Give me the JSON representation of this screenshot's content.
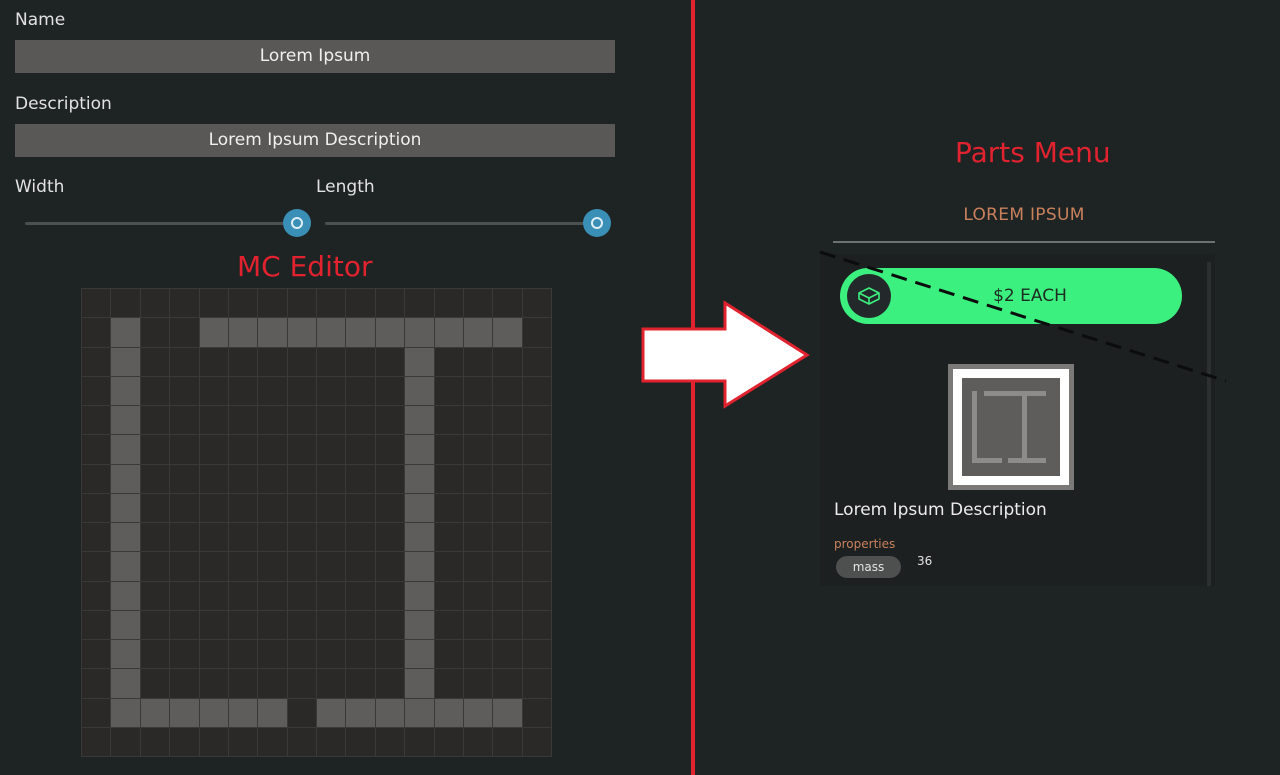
{
  "editor": {
    "name_label": "Name",
    "name_value": "Lorem Ipsum",
    "description_label": "Description",
    "description_value": "Lorem Ipsum Description",
    "width_label": "Width",
    "length_label": "Length",
    "width_slider_value": 1.0,
    "length_slider_value": 1.0,
    "annotation": "MC Editor",
    "grid": {
      "cols": 16,
      "rows": 16,
      "cells": [
        "0000000000000000",
        "0100111111111110",
        "0100000000010000",
        "0100000000010000",
        "0100000000010000",
        "0100000000010000",
        "0100000000010000",
        "0100000000010000",
        "0100000000010000",
        "0100000000010000",
        "0100000000010000",
        "0100000000010000",
        "0100000000010000",
        "0100000000010000",
        "0111111011111110",
        "0000000000000000"
      ]
    }
  },
  "parts_menu": {
    "annotation": "Parts Menu",
    "category_title": "LOREM IPSUM",
    "price_label": "$2 EACH",
    "price_icon": "box-icon",
    "part_description": "Lorem Ipsum Description",
    "properties_label": "properties",
    "property_name": "mass",
    "property_value": "36"
  },
  "colors": {
    "annotation": "#e0232e",
    "accent_green": "#3cf07f",
    "accent_orange": "#c9815c",
    "slider_blue": "#3a8fb7"
  }
}
